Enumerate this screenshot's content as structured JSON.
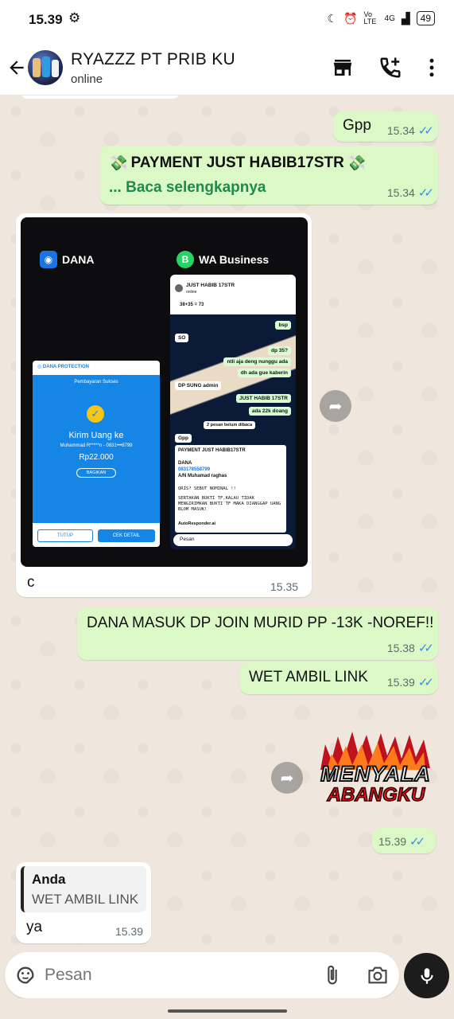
{
  "status": {
    "time": "15.39",
    "battery": "49",
    "network": "Vo LTE",
    "signal": "4G"
  },
  "header": {
    "name": "RYAZZZ PT PRIB KU",
    "status": "online"
  },
  "messages": {
    "m1": {
      "text": "Gpp",
      "time": "15.34"
    },
    "m2": {
      "title": "PAYMENT JUST HABIB17STR",
      "more": "... Baca selengkapnya",
      "time": "15.34",
      "emoji": "💸"
    },
    "m3": {
      "caption": "c",
      "time": "15.35",
      "image": {
        "dana_label": "DANA",
        "wa_label": "WA Business",
        "dana_success": "Pembayaran Sukses",
        "dana_send": "Kirim Uang ke",
        "dana_recipient": "Muhammad R*****n - 0831•••8799",
        "dana_amount": "Rp22.000",
        "dana_share": "BAGIKAN",
        "dana_close": "TUTUP",
        "dana_detail": "CEK DETAIL",
        "wa_chat_name": "JUST HABIB 17STR",
        "wa_chat_status": "online",
        "wa_calc": "38+35 = 73",
        "wa_input": "Pesan",
        "wa_bubbles": [
          "bsp",
          "SO",
          "dp 35?",
          "ntli aja deng nunggu ada",
          "dh ada gue kaberin",
          "DP SUNG admin",
          "JUST HABIB 17STR",
          "ada 22k doang",
          "2 pesan belum dibaca",
          "Gpp",
          "PAYMENT JUST HABIB17STR",
          "DANA",
          "083178558799",
          "A/N Muhamad raghas",
          "QRIS? SEBUT NOMINAL !!",
          "SERTAKAN BUKTI TF,KALAU TIDAK MENGIRIMKAN BUKTI TF MAKA DIANGGAP UANG BLOM MASUK!",
          "AutoResponder.ai"
        ]
      }
    },
    "m4": {
      "text": "DANA MASUK DP JOIN MURID PP -13K -NOREF!!",
      "time": "15.38"
    },
    "m5": {
      "text": "WET AMBIL LINK",
      "time": "15.39"
    },
    "m6": {
      "sticker_line1": "MENYALA",
      "sticker_line2": "ABANGKU",
      "time": "15.39"
    },
    "m7": {
      "quote_author": "Anda",
      "quote_text": "WET AMBIL LINK",
      "text": "ya",
      "time": "15.39"
    }
  },
  "input": {
    "placeholder": "Pesan"
  },
  "colors": {
    "outgoing": "#dcf8c6",
    "incoming": "#ffffff",
    "ticks": "#3b8fe0",
    "link": "#1e8a4f",
    "mic": "#1c1c1c"
  }
}
